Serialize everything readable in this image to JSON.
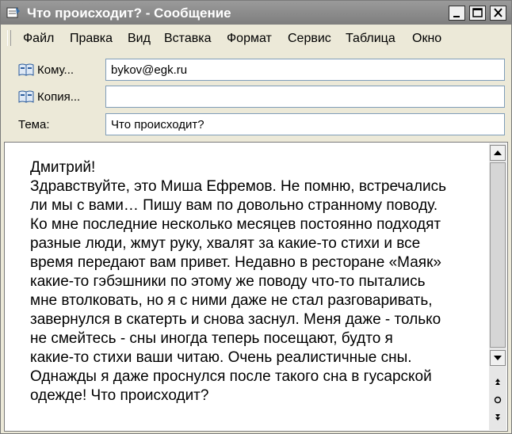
{
  "window": {
    "title": "Что происходит? - Сообщение"
  },
  "menu": {
    "items": [
      "Файл",
      "Правка",
      "Вид",
      "Вставка",
      "Формат",
      "Сервис",
      "Таблица",
      "Окно"
    ]
  },
  "header": {
    "to_button": "Кому...",
    "to_value": "bykov@egk.ru",
    "cc_button": "Копия...",
    "cc_value": "",
    "subject_label": "Тема:",
    "subject_value": "Что происходит?"
  },
  "message": {
    "body": "Дмитрий!\nЗдравствуйте, это Миша Ефремов. Не помню, встречались\nли мы с вами… Пишу вам по довольно странному поводу.\nКо мне последние несколько месяцев постоянно подходят\nразные люди, жмут руку, хвалят за какие-то стихи и все\nвремя передают вам привет. Недавно в ресторане «Маяк»\nкакие-то гэбэшники по этому же поводу что-то пытались\nмне втолковать, но я с ними даже не стал разговаривать,\nзавернулся в скатерть и снова заснул. Меня даже - только\nне смейтесь - сны иногда теперь посещают, будто я\nкакие-то стихи ваши читаю. Очень реалистичные сны.\nОднажды я даже проснулся после такого сна в гусарской\nодежде! Что происходит?"
  },
  "icons": {
    "title": "message-icon",
    "minimize": "minimize-icon",
    "maximize": "maximize-icon",
    "close": "close-icon",
    "address_book": "address-book-icon",
    "scroll_up": "scroll-up-icon",
    "scroll_down": "scroll-down-icon",
    "prev": "previous-object-icon",
    "select_browse": "select-browse-object-icon",
    "next": "next-object-icon"
  }
}
